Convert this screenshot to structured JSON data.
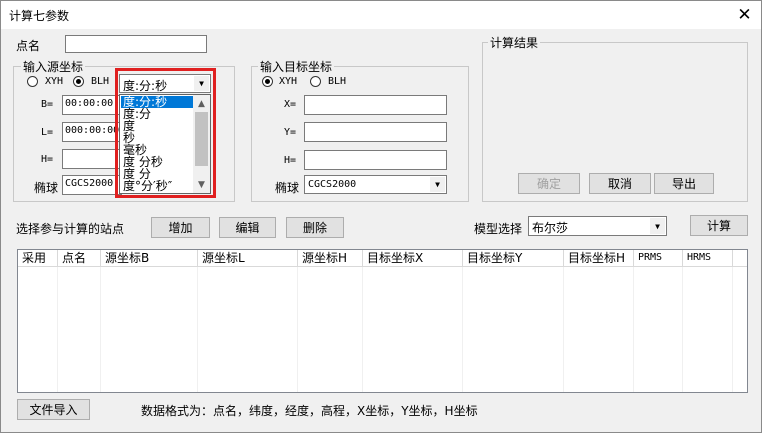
{
  "window": {
    "title": "计算七参数",
    "close_glyph": "✕"
  },
  "point_name": {
    "label": "点名",
    "value": ""
  },
  "source": {
    "group_title": "输入源坐标",
    "radio_xyh": "XYH",
    "radio_blh": "BLH",
    "selected_radio": "BLH",
    "format_combo_value": "度:分:秒",
    "b_label": "B=",
    "b_value": "00:00:00",
    "l_label": "L=",
    "l_value": "000:00:00",
    "h_label": "H=",
    "h_value": "",
    "ellipsoid_label": "椭球",
    "ellipsoid_value": "CGCS2000"
  },
  "format_dropdown": {
    "items": [
      "度:分:秒",
      "度:分",
      "度",
      "秒",
      "毫秒",
      "度 分秒",
      "度 分",
      "度°分′秒″"
    ],
    "selected_index": 0
  },
  "target": {
    "group_title": "输入目标坐标",
    "radio_xyh": "XYH",
    "radio_blh": "BLH",
    "selected_radio": "XYH",
    "x_label": "X=",
    "x_value": "",
    "y_label": "Y=",
    "y_value": "",
    "h_label": "H=",
    "h_value": "",
    "ellipsoid_label": "椭球",
    "ellipsoid_value": "CGCS2000"
  },
  "result": {
    "group_title": "计算结果",
    "ok_label": "确定",
    "cancel_label": "取消",
    "export_label": "导出"
  },
  "stations": {
    "label": "选择参与计算的站点",
    "add_label": "增加",
    "edit_label": "编辑",
    "delete_label": "删除",
    "model_label": "模型选择",
    "model_value": "布尔莎",
    "compute_label": "计算"
  },
  "table": {
    "columns": [
      "采用",
      "点名",
      "源坐标B",
      "源坐标L",
      "源坐标H",
      "目标坐标X",
      "目标坐标Y",
      "目标坐标H",
      "PRMS",
      "HRMS"
    ],
    "rows": []
  },
  "footer": {
    "import_label": "文件导入",
    "format_hint": "数据格式为：点名，纬度，经度，高程，X坐标，Y坐标，H坐标"
  },
  "colors": {
    "highlight": "#e02020",
    "selection": "#0078d7",
    "dialog_bg": "#f0f0f0"
  }
}
